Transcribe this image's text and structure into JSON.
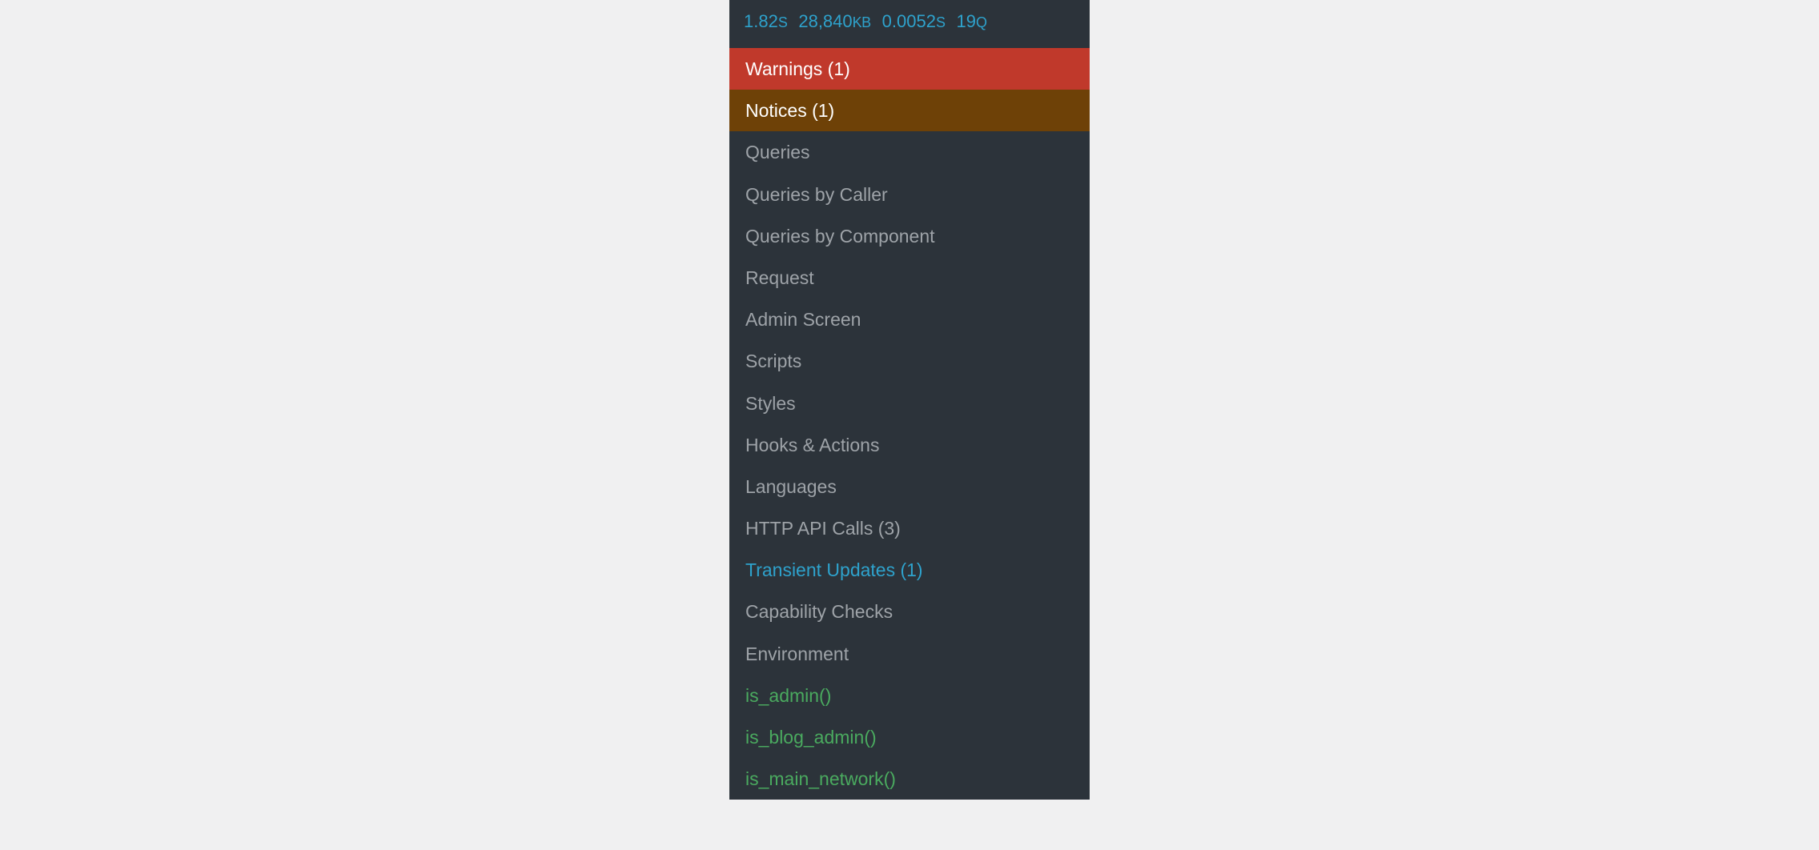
{
  "stats": {
    "load_time": {
      "value": "1.82",
      "unit": "S"
    },
    "memory": {
      "value": "28,840",
      "unit": "KB"
    },
    "query_time": {
      "value": "0.0052",
      "unit": "S"
    },
    "query_count": {
      "value": "19",
      "unit": "Q"
    }
  },
  "menu": {
    "items": [
      {
        "label": "Warnings (1)",
        "variant": "warning"
      },
      {
        "label": "Notices (1)",
        "variant": "notice"
      },
      {
        "label": "Queries",
        "variant": ""
      },
      {
        "label": "Queries by Caller",
        "variant": ""
      },
      {
        "label": "Queries by Component",
        "variant": ""
      },
      {
        "label": "Request",
        "variant": ""
      },
      {
        "label": "Admin Screen",
        "variant": ""
      },
      {
        "label": "Scripts",
        "variant": ""
      },
      {
        "label": "Styles",
        "variant": ""
      },
      {
        "label": "Hooks & Actions",
        "variant": ""
      },
      {
        "label": "Languages",
        "variant": ""
      },
      {
        "label": "HTTP API Calls (3)",
        "variant": ""
      },
      {
        "label": "Transient Updates (1)",
        "variant": "active"
      },
      {
        "label": "Capability Checks",
        "variant": ""
      },
      {
        "label": "Environment",
        "variant": ""
      },
      {
        "label": "is_admin()",
        "variant": "func"
      },
      {
        "label": "is_blog_admin()",
        "variant": "func"
      },
      {
        "label": "is_main_network()",
        "variant": "func"
      }
    ]
  }
}
